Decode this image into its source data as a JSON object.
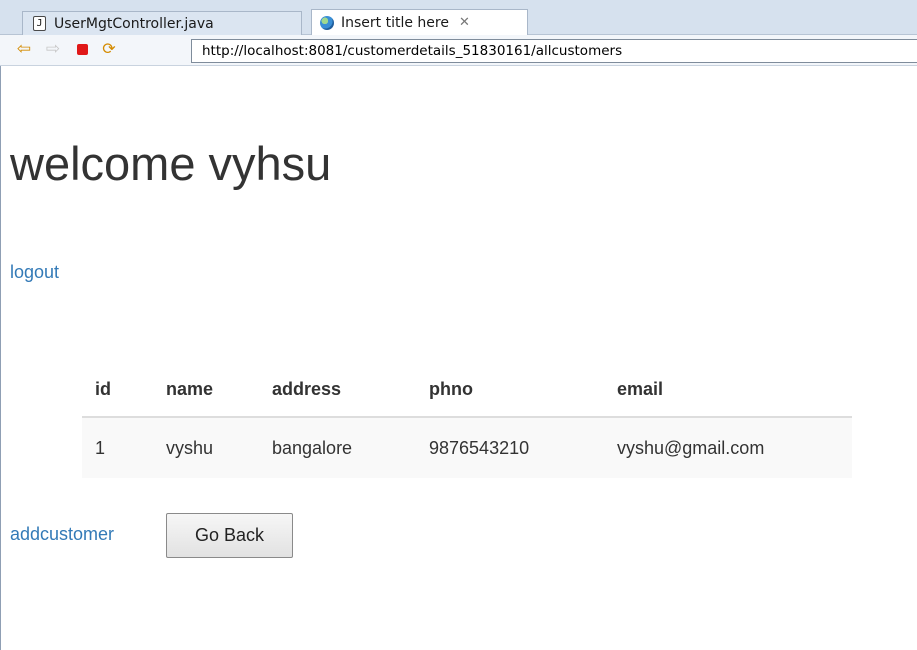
{
  "tabs": [
    {
      "label": "UserMgtController.java",
      "icon": "java-file-icon"
    },
    {
      "label": "Insert title here",
      "icon": "globe-icon",
      "close": "⊠"
    }
  ],
  "navbar": {
    "url": "http://localhost:8081/customerdetails_51830161/allcustomers"
  },
  "page": {
    "title": "welcome vyhsu",
    "logout_link": "logout",
    "add_link": "addcustomer",
    "goback_button": "Go Back"
  },
  "table": {
    "headers": [
      "id",
      "name",
      "address",
      "phno",
      "email"
    ],
    "rows": [
      [
        "1",
        "vyshu",
        "bangalore",
        "9876543210",
        "vyshu@gmail.com"
      ]
    ]
  },
  "colors": {
    "link": "#337ab7",
    "heading": "#333333",
    "tabbar": "#d6e1ee"
  }
}
